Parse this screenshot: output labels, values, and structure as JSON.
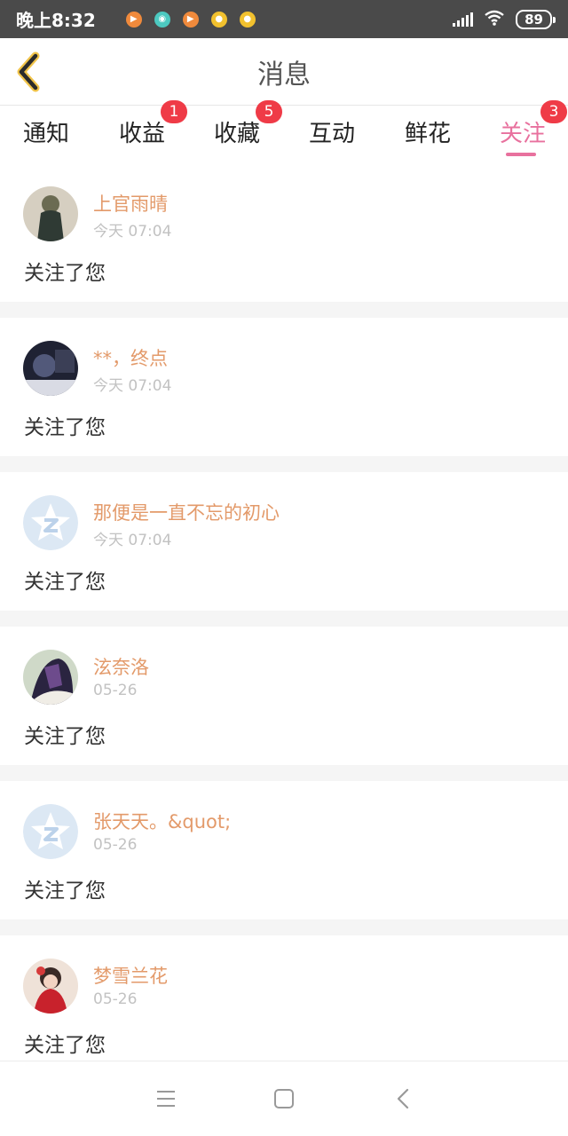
{
  "status_bar": {
    "time": "晚上8:32",
    "battery": "89",
    "apps": [
      {
        "icon": "video-app-icon",
        "color": "#f08a3c",
        "glyph": "▶"
      },
      {
        "icon": "chat-app-icon",
        "color": "#4cc9c0",
        "glyph": "◉"
      },
      {
        "icon": "video-app-icon",
        "color": "#f08a3c",
        "glyph": "▶"
      },
      {
        "icon": "bulb-app-icon",
        "color": "#f2c12e",
        "glyph": "●"
      },
      {
        "icon": "bulb-app-icon",
        "color": "#f2c12e",
        "glyph": "●"
      }
    ]
  },
  "header": {
    "title": "消息"
  },
  "tabs": [
    {
      "label": "通知",
      "badge": ""
    },
    {
      "label": "收益",
      "badge": "1"
    },
    {
      "label": "收藏",
      "badge": "5"
    },
    {
      "label": "互动",
      "badge": ""
    },
    {
      "label": "鲜花",
      "badge": ""
    },
    {
      "label": "关注",
      "badge": "3"
    }
  ],
  "active_tab": "关注",
  "messages": [
    {
      "name": "上官雨晴",
      "time": "今天 07:04",
      "text": "关注了您",
      "avatar": "photo-dark-dress"
    },
    {
      "name": "**，终点",
      "time": "今天 07:04",
      "text": "关注了您",
      "avatar": "photo-dark-blue"
    },
    {
      "name": "那便是一直不忘的初心",
      "time": "今天 07:04",
      "text": "关注了您",
      "avatar": "qzone-default"
    },
    {
      "name": "泫奈洛",
      "time": "05-26",
      "text": "关注了您",
      "avatar": "anime-purple"
    },
    {
      "name": "张天天。&quot;",
      "time": "05-26",
      "text": "关注了您",
      "avatar": "qzone-default"
    },
    {
      "name": "梦雪兰花",
      "time": "05-26",
      "text": "关注了您",
      "avatar": "anime-red"
    }
  ],
  "colors": {
    "accent": "#e8719e",
    "name": "#e39a6a",
    "badge": "#ef3b47",
    "status_bar": "#4a4a4a"
  }
}
